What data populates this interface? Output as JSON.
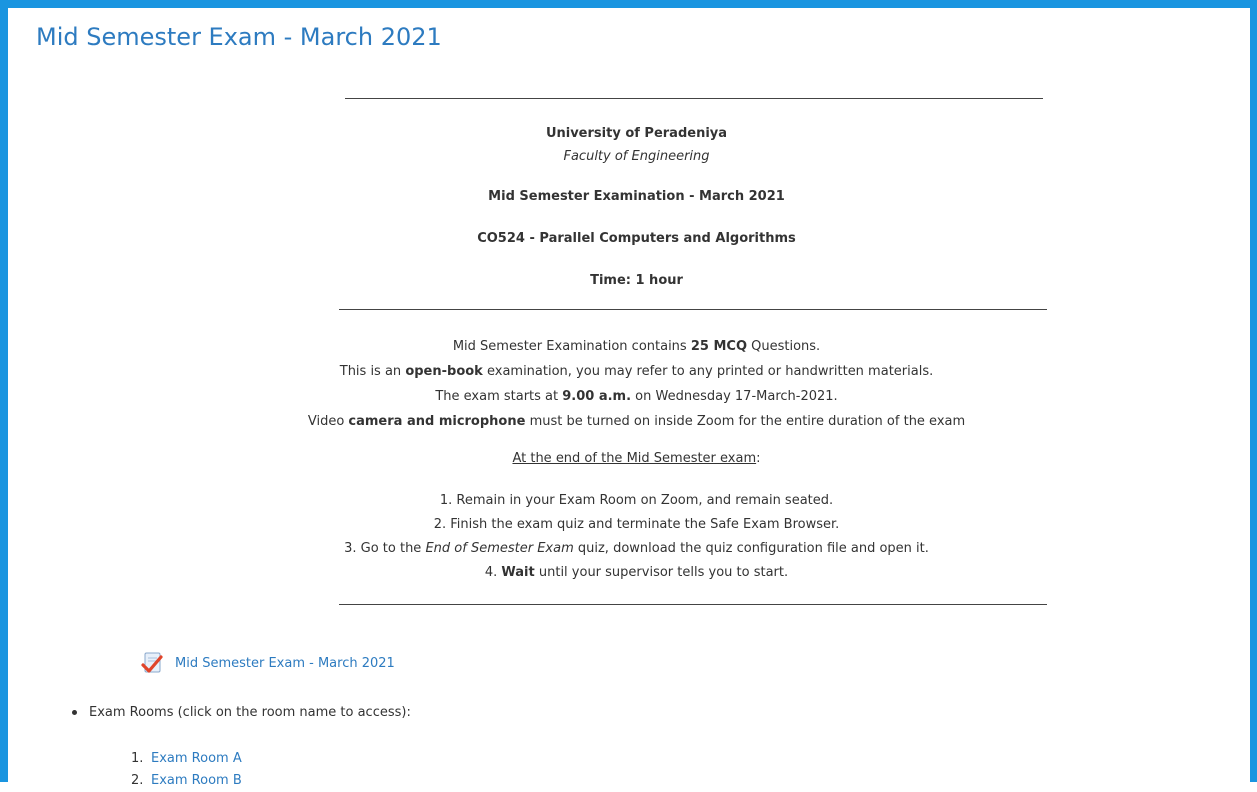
{
  "page": {
    "title": "Mid Semester Exam - March 2021"
  },
  "notice": {
    "university": "University of Peradeniya",
    "faculty": "Faculty of Engineering",
    "exam_name": "Mid Semester Examination - March 2021",
    "course": "CO524 - Parallel Computers and Algorithms",
    "time": "Time: 1 hour",
    "line1_a": "Mid Semester Examination contains ",
    "line1_b": "25 MCQ",
    "line1_c": " Questions.",
    "line2_a": "This is an ",
    "line2_b": "open-book",
    "line2_c": " examination, you may refer to any printed or handwritten materials.",
    "line3_a": "The exam starts at ",
    "line3_b": "9.00 a.m.",
    "line3_c": " on Wednesday 17-March-2021.",
    "line4_a": "Video ",
    "line4_b": "camera and microphone",
    "line4_c": " must be turned on inside Zoom for the entire duration of the exam",
    "end_heading": "At the end of the Mid Semester exam",
    "end_colon": ":",
    "step1": "1. Remain in your Exam Room on Zoom, and remain seated.",
    "step2": "2. Finish the exam quiz and terminate the Safe Exam Browser.",
    "step3_a": "3. Go to the ",
    "step3_b": "End of Semester Exam",
    "step3_c": " quiz, download the quiz configuration file and open it.",
    "step4_a": "4. ",
    "step4_b": "Wait",
    "step4_c": " until your supervisor tells you to start."
  },
  "quiz": {
    "icon": "quiz-checkmark-icon",
    "label": "Mid Semester Exam - March 2021"
  },
  "rooms": {
    "intro": "Exam Rooms (click on the room name to access):",
    "items": [
      {
        "num": "1.",
        "label": "Exam Room A"
      },
      {
        "num": "2.",
        "label": "Exam Room B"
      }
    ]
  },
  "colors": {
    "frame": "#1a95e0",
    "link": "#2d7bc0",
    "text": "#333333"
  }
}
